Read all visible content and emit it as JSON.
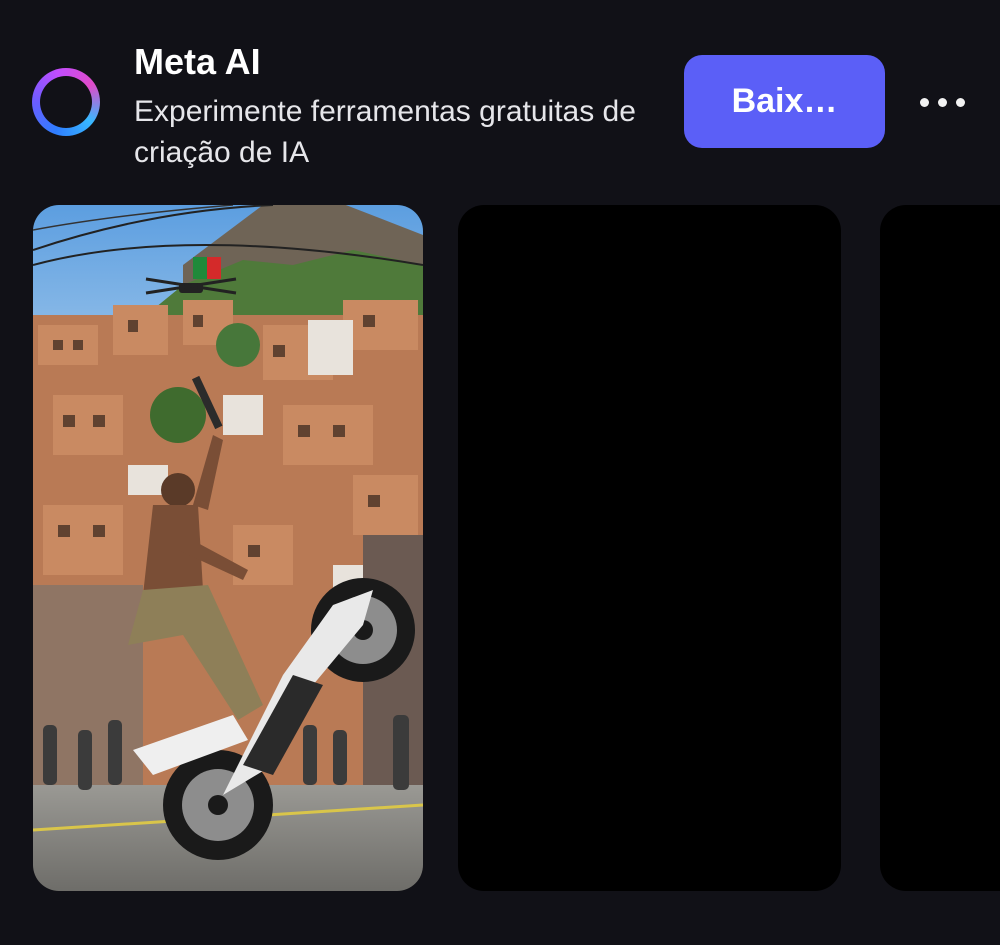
{
  "ad": {
    "title": "Meta AI",
    "subtitle": "Experimente ferramentas gratuitas de criação de IA",
    "cta_label": "Baix…",
    "logo_icon": "meta-ai-ring-icon",
    "more_icon": "more-horizontal-icon"
  },
  "colors": {
    "background": "#111117",
    "button": "#5b5ff7",
    "text": "#ffffff"
  },
  "gallery": {
    "cards": [
      {
        "content": "image"
      },
      {
        "content": "empty"
      },
      {
        "content": "empty"
      }
    ]
  }
}
